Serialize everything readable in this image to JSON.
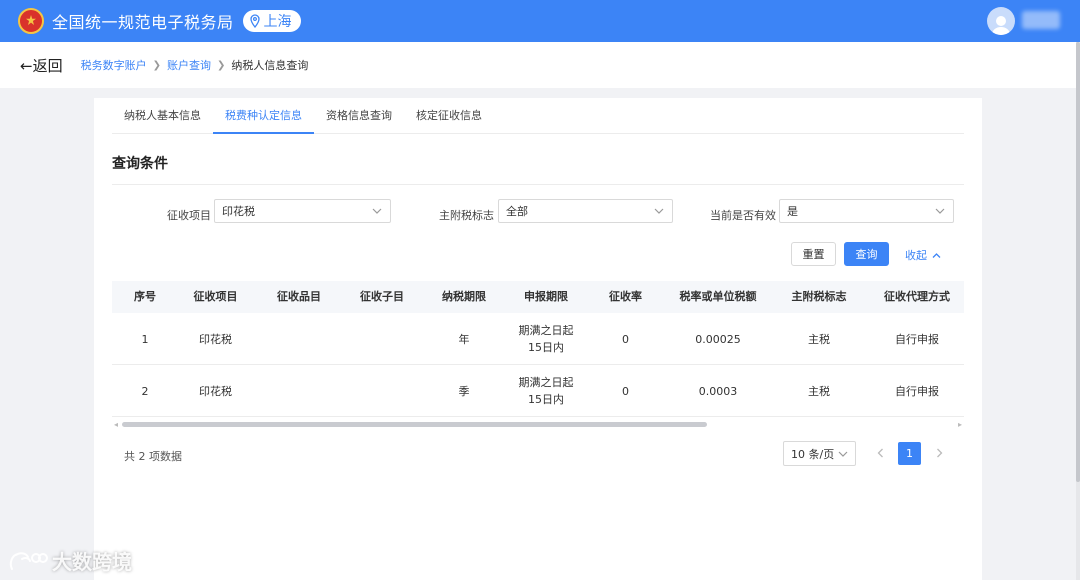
{
  "header": {
    "title": "全国统一规范电子税务局",
    "region": "上海",
    "brand_color": "#3c84f6"
  },
  "nav": {
    "back_label": "←返回",
    "breadcrumb": [
      "税务数字账户",
      "账户查询",
      "纳税人信息查询"
    ]
  },
  "tabs": [
    {
      "label": "纳税人基本信息",
      "active": false
    },
    {
      "label": "税费种认定信息",
      "active": true
    },
    {
      "label": "资格信息查询",
      "active": false
    },
    {
      "label": "核定征收信息",
      "active": false
    }
  ],
  "query": {
    "section_title": "查询条件",
    "filters": [
      {
        "label": "征收项目",
        "value": "印花税"
      },
      {
        "label": "主附税标志",
        "value": "全部"
      },
      {
        "label": "当前是否有效",
        "value": "是"
      }
    ],
    "reset_label": "重置",
    "search_label": "查询",
    "collapse_label": "收起"
  },
  "table": {
    "columns": [
      "序号",
      "征收项目",
      "征收品目",
      "征收子目",
      "纳税期限",
      "申报期限",
      "征收率",
      "税率或单位税额",
      "主附税标志",
      "征收代理方式"
    ],
    "rows": [
      [
        "1",
        "印花税",
        "",
        "",
        "年",
        "期满之日起\n15日内",
        "0",
        "0.00025",
        "主税",
        "自行申报"
      ],
      [
        "2",
        "印花税",
        "",
        "",
        "季",
        "期满之日起\n15日内",
        "0",
        "0.0003",
        "主税",
        "自行申报"
      ]
    ]
  },
  "pagination": {
    "total_text": "共 2 项数据",
    "page_size": "10 条/页",
    "current_page": "1"
  },
  "watermark": "大数跨境"
}
